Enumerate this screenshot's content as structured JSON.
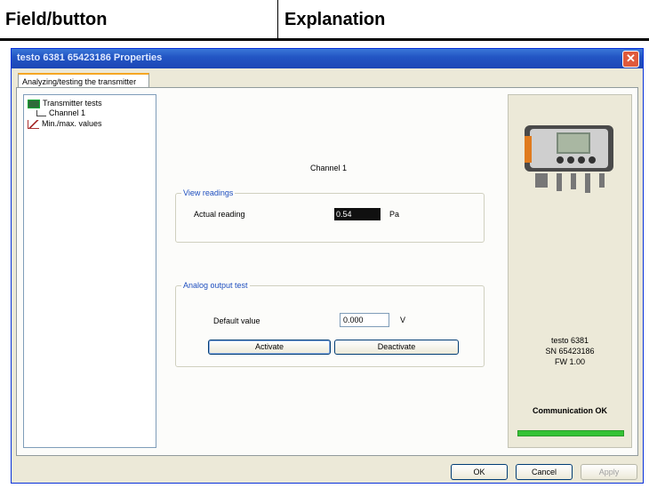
{
  "doc_header": {
    "col1": "Field/button",
    "col2": "Explanation"
  },
  "window": {
    "title": "testo 6381 65423186 Properties",
    "close_glyph": "✕"
  },
  "tab": {
    "label": "Analyzing/testing the transmitter"
  },
  "tree": {
    "items": [
      {
        "label": "Transmitter tests",
        "icon": "transmitter-icon"
      },
      {
        "label": "Channel 1",
        "icon": "channel-icon"
      },
      {
        "label": "Min./max. values",
        "icon": "chart-icon"
      }
    ]
  },
  "main": {
    "channel_title": "Channel 1",
    "view_readings": {
      "legend": "View readings",
      "label": "Actual reading",
      "value": "0.54",
      "unit": "Pa"
    },
    "analog_output": {
      "legend": "Analog output test",
      "label": "Default value",
      "value": "0.000",
      "unit": "V",
      "activate_label": "Activate",
      "deactivate_label": "Deactivate"
    }
  },
  "device": {
    "model": "testo 6381",
    "serial": "SN 65423186",
    "firmware": "FW 1.00",
    "comm_status": "Communication OK",
    "comm_color": "#35c335"
  },
  "buttons": {
    "ok": "OK",
    "cancel": "Cancel",
    "apply": "Apply"
  }
}
